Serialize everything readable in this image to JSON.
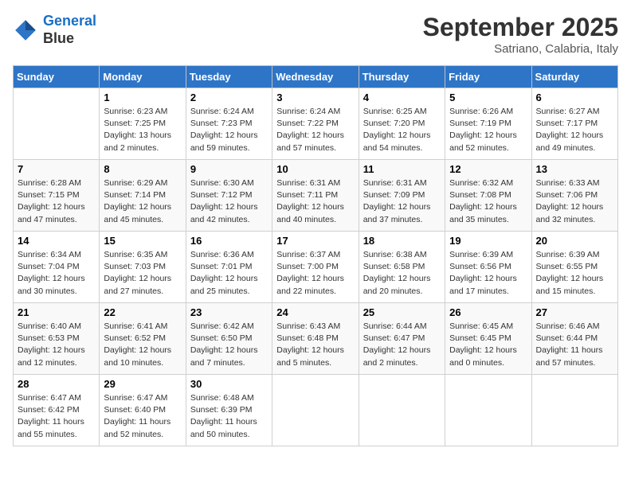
{
  "header": {
    "logo_line1": "General",
    "logo_line2": "Blue",
    "month": "September 2025",
    "location": "Satriano, Calabria, Italy"
  },
  "days_of_week": [
    "Sunday",
    "Monday",
    "Tuesday",
    "Wednesday",
    "Thursday",
    "Friday",
    "Saturday"
  ],
  "weeks": [
    [
      {
        "day": "",
        "text": ""
      },
      {
        "day": "1",
        "text": "Sunrise: 6:23 AM\nSunset: 7:25 PM\nDaylight: 13 hours\nand 2 minutes."
      },
      {
        "day": "2",
        "text": "Sunrise: 6:24 AM\nSunset: 7:23 PM\nDaylight: 12 hours\nand 59 minutes."
      },
      {
        "day": "3",
        "text": "Sunrise: 6:24 AM\nSunset: 7:22 PM\nDaylight: 12 hours\nand 57 minutes."
      },
      {
        "day": "4",
        "text": "Sunrise: 6:25 AM\nSunset: 7:20 PM\nDaylight: 12 hours\nand 54 minutes."
      },
      {
        "day": "5",
        "text": "Sunrise: 6:26 AM\nSunset: 7:19 PM\nDaylight: 12 hours\nand 52 minutes."
      },
      {
        "day": "6",
        "text": "Sunrise: 6:27 AM\nSunset: 7:17 PM\nDaylight: 12 hours\nand 49 minutes."
      }
    ],
    [
      {
        "day": "7",
        "text": "Sunrise: 6:28 AM\nSunset: 7:15 PM\nDaylight: 12 hours\nand 47 minutes."
      },
      {
        "day": "8",
        "text": "Sunrise: 6:29 AM\nSunset: 7:14 PM\nDaylight: 12 hours\nand 45 minutes."
      },
      {
        "day": "9",
        "text": "Sunrise: 6:30 AM\nSunset: 7:12 PM\nDaylight: 12 hours\nand 42 minutes."
      },
      {
        "day": "10",
        "text": "Sunrise: 6:31 AM\nSunset: 7:11 PM\nDaylight: 12 hours\nand 40 minutes."
      },
      {
        "day": "11",
        "text": "Sunrise: 6:31 AM\nSunset: 7:09 PM\nDaylight: 12 hours\nand 37 minutes."
      },
      {
        "day": "12",
        "text": "Sunrise: 6:32 AM\nSunset: 7:08 PM\nDaylight: 12 hours\nand 35 minutes."
      },
      {
        "day": "13",
        "text": "Sunrise: 6:33 AM\nSunset: 7:06 PM\nDaylight: 12 hours\nand 32 minutes."
      }
    ],
    [
      {
        "day": "14",
        "text": "Sunrise: 6:34 AM\nSunset: 7:04 PM\nDaylight: 12 hours\nand 30 minutes."
      },
      {
        "day": "15",
        "text": "Sunrise: 6:35 AM\nSunset: 7:03 PM\nDaylight: 12 hours\nand 27 minutes."
      },
      {
        "day": "16",
        "text": "Sunrise: 6:36 AM\nSunset: 7:01 PM\nDaylight: 12 hours\nand 25 minutes."
      },
      {
        "day": "17",
        "text": "Sunrise: 6:37 AM\nSunset: 7:00 PM\nDaylight: 12 hours\nand 22 minutes."
      },
      {
        "day": "18",
        "text": "Sunrise: 6:38 AM\nSunset: 6:58 PM\nDaylight: 12 hours\nand 20 minutes."
      },
      {
        "day": "19",
        "text": "Sunrise: 6:39 AM\nSunset: 6:56 PM\nDaylight: 12 hours\nand 17 minutes."
      },
      {
        "day": "20",
        "text": "Sunrise: 6:39 AM\nSunset: 6:55 PM\nDaylight: 12 hours\nand 15 minutes."
      }
    ],
    [
      {
        "day": "21",
        "text": "Sunrise: 6:40 AM\nSunset: 6:53 PM\nDaylight: 12 hours\nand 12 minutes."
      },
      {
        "day": "22",
        "text": "Sunrise: 6:41 AM\nSunset: 6:52 PM\nDaylight: 12 hours\nand 10 minutes."
      },
      {
        "day": "23",
        "text": "Sunrise: 6:42 AM\nSunset: 6:50 PM\nDaylight: 12 hours\nand 7 minutes."
      },
      {
        "day": "24",
        "text": "Sunrise: 6:43 AM\nSunset: 6:48 PM\nDaylight: 12 hours\nand 5 minutes."
      },
      {
        "day": "25",
        "text": "Sunrise: 6:44 AM\nSunset: 6:47 PM\nDaylight: 12 hours\nand 2 minutes."
      },
      {
        "day": "26",
        "text": "Sunrise: 6:45 AM\nSunset: 6:45 PM\nDaylight: 12 hours\nand 0 minutes."
      },
      {
        "day": "27",
        "text": "Sunrise: 6:46 AM\nSunset: 6:44 PM\nDaylight: 11 hours\nand 57 minutes."
      }
    ],
    [
      {
        "day": "28",
        "text": "Sunrise: 6:47 AM\nSunset: 6:42 PM\nDaylight: 11 hours\nand 55 minutes."
      },
      {
        "day": "29",
        "text": "Sunrise: 6:47 AM\nSunset: 6:40 PM\nDaylight: 11 hours\nand 52 minutes."
      },
      {
        "day": "30",
        "text": "Sunrise: 6:48 AM\nSunset: 6:39 PM\nDaylight: 11 hours\nand 50 minutes."
      },
      {
        "day": "",
        "text": ""
      },
      {
        "day": "",
        "text": ""
      },
      {
        "day": "",
        "text": ""
      },
      {
        "day": "",
        "text": ""
      }
    ]
  ]
}
